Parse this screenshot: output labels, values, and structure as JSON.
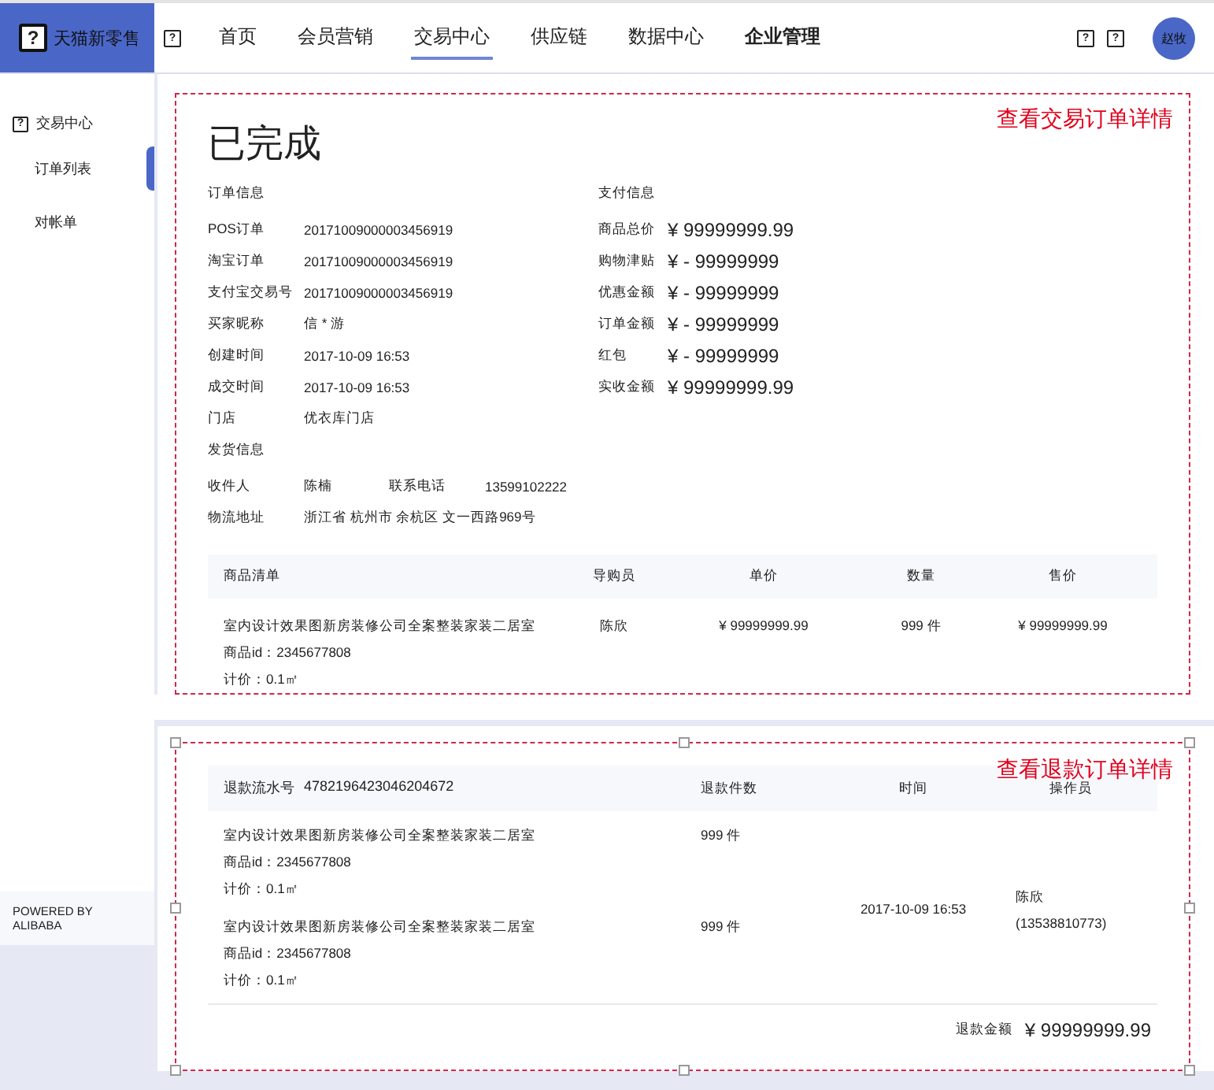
{
  "header": {
    "logo_icon": "?",
    "logo_text": "天猫新零售",
    "nav_icon": "?",
    "nav": [
      {
        "label": "首页",
        "selected": false,
        "emphasized": false
      },
      {
        "label": "会员营销",
        "selected": false,
        "emphasized": false
      },
      {
        "label": "交易中心",
        "selected": true,
        "emphasized": false
      },
      {
        "label": "供应链",
        "selected": false,
        "emphasized": false
      },
      {
        "label": "数据中心",
        "selected": false,
        "emphasized": false
      },
      {
        "label": "企业管理",
        "selected": false,
        "emphasized": true
      }
    ],
    "action_icons": [
      "?",
      "?"
    ],
    "avatar": "赵牧"
  },
  "sidebar": {
    "section_icon": "?",
    "section": "交易中心",
    "items": [
      {
        "label": "订单列表",
        "selected": true
      },
      {
        "label": "对帐单",
        "selected": false
      }
    ],
    "footer": "POWERED BY ALIBABA"
  },
  "order_card": {
    "annotation": "查看交易订单详情",
    "status": "已完成",
    "order_info": {
      "title": "订单信息",
      "rows": [
        {
          "label": "POS订单",
          "value": "20171009000003456919"
        },
        {
          "label": "淘宝订单",
          "value": "20171009000003456919"
        },
        {
          "label": "支付宝交易号",
          "value": "20171009000003456919"
        },
        {
          "label": "买家昵称",
          "value": "信 * 游"
        },
        {
          "label": "创建时间",
          "value": "2017-10-09 16:53"
        },
        {
          "label": "成交时间",
          "value": "2017-10-09 16:53"
        },
        {
          "label": "门店",
          "value": "优衣库门店"
        }
      ]
    },
    "payment_info": {
      "title": "支付信息",
      "rows": [
        {
          "label": "商品总价",
          "value": "¥ 99999999.99"
        },
        {
          "label": "购物津贴",
          "value": "¥ - 99999999"
        },
        {
          "label": "优惠金额",
          "value": "¥ - 99999999"
        },
        {
          "label": "订单金额",
          "value": "¥ - 99999999"
        },
        {
          "label": "红包",
          "value": "¥ - 99999999"
        },
        {
          "label": "实收金额",
          "value": "¥ 99999999.99"
        }
      ]
    },
    "shipping": {
      "title": "发货信息",
      "receiver_label": "收件人",
      "receiver": "陈楠",
      "phone_label": "联系电话",
      "phone": "13599102222",
      "address_label": "物流地址",
      "address": "浙江省 杭州市 余杭区 文一西路969号"
    },
    "goods_table": {
      "columns": [
        "商品清单",
        "导购员",
        "单价",
        "数量",
        "售价"
      ],
      "rows": [
        {
          "name": "室内设计效果图新房装修公司全案整装家装二居室",
          "product_id": "商品id：2345677808",
          "pricing": "计价：0.1㎡",
          "guide": "陈欣",
          "unit_price": "¥ 99999999.99",
          "quantity": "999 件",
          "sale_price": "¥ 99999999.99"
        }
      ]
    }
  },
  "refund_card": {
    "annotation": "查看退款订单详情",
    "serial_label": "退款流水号",
    "serial": "4782196423046204672",
    "columns": [
      "退款件数",
      "时间",
      "操作员"
    ],
    "items": [
      {
        "name": "室内设计效果图新房装修公司全案整装家装二居室",
        "product_id": "商品id：2345677808",
        "pricing": "计价：0.1㎡",
        "quantity": "999 件"
      },
      {
        "name": "室内设计效果图新房装修公司全案整装家装二居室",
        "product_id": "商品id：2345677808",
        "pricing": "计价：0.1㎡",
        "quantity": "999 件"
      }
    ],
    "time": "2017-10-09 16:53",
    "operator": "陈欣",
    "operator_phone": "(13538810773)",
    "total_label": "退款金额",
    "total": "¥ 99999999.99"
  }
}
